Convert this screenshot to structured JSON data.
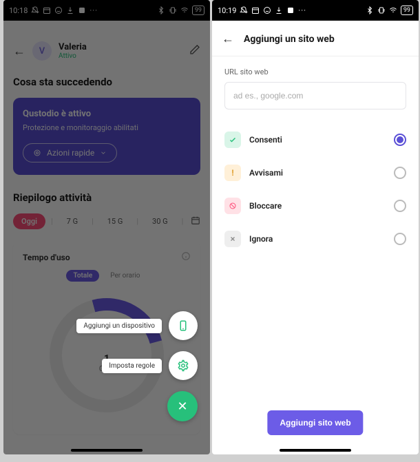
{
  "left": {
    "status": {
      "time": "10:18",
      "battery": "99"
    },
    "user": {
      "initial": "V",
      "name": "Valeria",
      "status": "Attivo"
    },
    "whats_happening": "Cosa sta succedendo",
    "card": {
      "title": "Qustodio è attivo",
      "subtitle": "Protezione e monitoraggio abilitati",
      "quick": "Azioni rapide"
    },
    "summary_title": "Riepilogo attività",
    "ranges": [
      "Oggi",
      "7 G",
      "15 G",
      "30 G"
    ],
    "usage": {
      "title": "Tempo d'uso",
      "seg_total": "Totale",
      "seg_sched": "Per orario",
      "value": "1",
      "sub": "Oggi"
    },
    "fab": {
      "device": "Aggiungi un dispositivo",
      "rules": "Imposta regole"
    }
  },
  "right": {
    "status": {
      "time": "10:19",
      "battery": "99"
    },
    "title": "Aggiungi un sito web",
    "field_label": "URL sito web",
    "placeholder": "ad es., google.com",
    "options": [
      {
        "label": "Consenti",
        "kind": "allow",
        "checked": true
      },
      {
        "label": "Avvisami",
        "kind": "alert",
        "checked": false
      },
      {
        "label": "Bloccare",
        "kind": "block",
        "checked": false
      },
      {
        "label": "Ignora",
        "kind": "ignore",
        "checked": false
      }
    ],
    "add_button": "Aggiungi sito web"
  }
}
